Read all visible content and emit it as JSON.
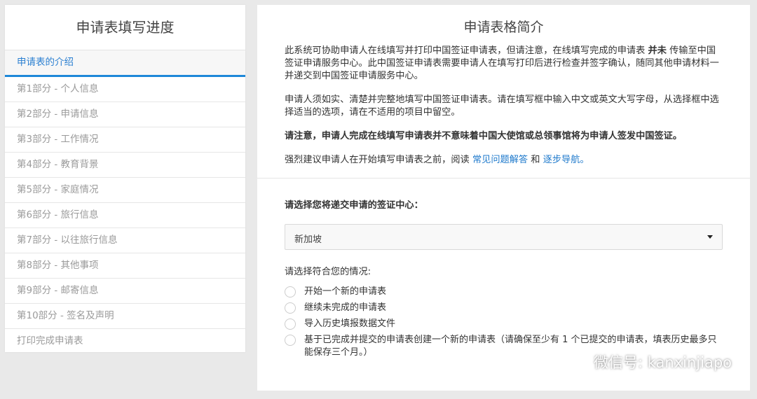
{
  "sidebar": {
    "title": "申请表填写进度",
    "items": [
      {
        "label": "申请表的介绍",
        "active": true
      },
      {
        "label": "第1部分 - 个人信息"
      },
      {
        "label": "第2部分 - 申请信息"
      },
      {
        "label": "第3部分 - 工作情况"
      },
      {
        "label": "第4部分 - 教育背景"
      },
      {
        "label": "第5部分 - 家庭情况"
      },
      {
        "label": "第6部分 - 旅行信息"
      },
      {
        "label": "第7部分 - 以往旅行信息"
      },
      {
        "label": "第8部分 - 其他事项"
      },
      {
        "label": "第9部分 - 邮寄信息"
      },
      {
        "label": "第10部分 - 签名及声明"
      },
      {
        "label": "打印完成申请表"
      }
    ]
  },
  "main": {
    "title": "申请表格简介",
    "para1_pre": "此系统可协助申请人在线填写并打印中国签证申请表，但请注意，在线填写完成的申请表 ",
    "para1_bold": "并未",
    "para1_post": " 传输至中国签证申请服务中心。此中国签证申请表需要申请人在填写打印后进行检查并签字确认，随同其他申请材料一并递交到中国签证申请服务中心。",
    "para2": "申请人须如实、清楚并完整地填写中国签证申请表。请在填写框中输入中文或英文大写字母，从选择框中选择适当的选项，请在不适用的项目中留空。",
    "para3": "请注意，申请人完成在线填写申请表并不意味着中国大使馆或总领事馆将为申请人签发中国签证。",
    "para4_pre": "强烈建议申请人在开始填写申请表之前，阅读 ",
    "para4_link1": "常见问题解答",
    "para4_mid": " 和 ",
    "para4_link2": "逐步导航。",
    "center_label": "请选择您将递交申请的签证中心：",
    "center_selected": "新加坡",
    "situation_label": "请选择符合您的情况:",
    "options": [
      "开始一个新的申请表",
      "继续未完成的申请表",
      "导入历史填报数据文件",
      "基于已完成并提交的申请表创建一个新的申请表（请确保至少有 1 个已提交的申请表，填表历史最多只能保存三个月。）"
    ]
  },
  "watermark": {
    "text": "微信号: kanxinjiapo"
  },
  "colors": {
    "accent": "#1e88d8",
    "link": "#1f7acc"
  }
}
